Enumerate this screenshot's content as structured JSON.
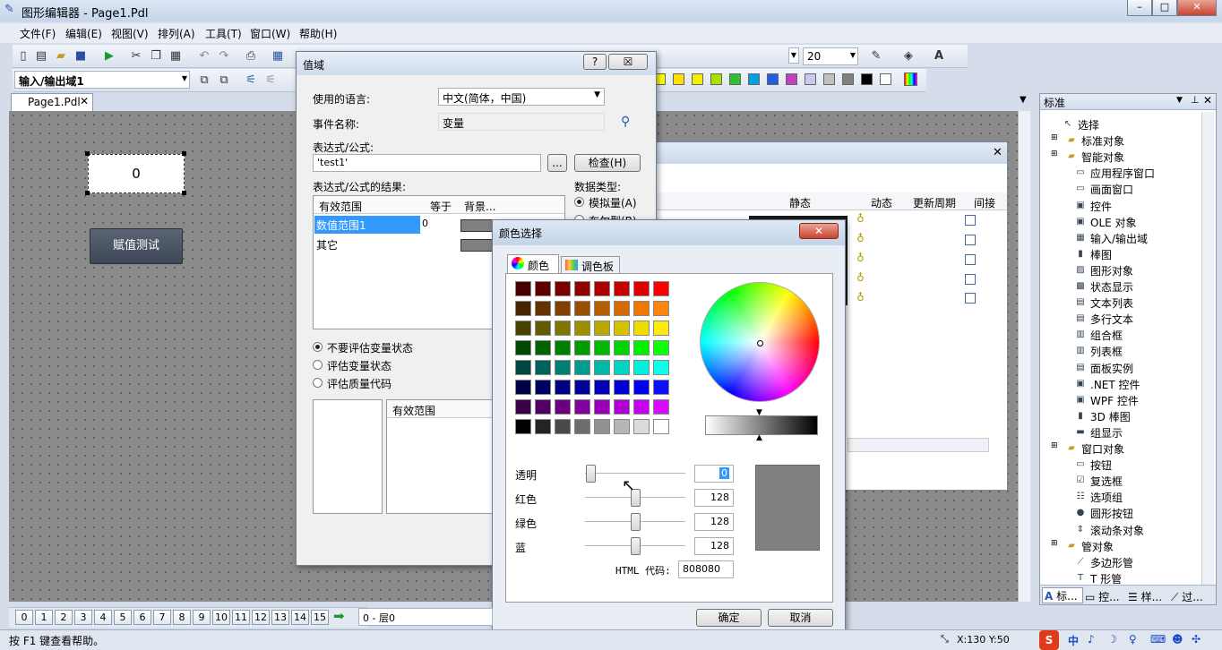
{
  "app": {
    "title": "图形编辑器 - Page1.Pdl"
  },
  "menu": [
    "文件(F)",
    "编辑(E)",
    "视图(V)",
    "排列(A)",
    "工具(T)",
    "窗口(W)",
    "帮助(H)"
  ],
  "toolbar": {
    "field_label": "输入/输出域1",
    "font_size": "20"
  },
  "palette": [
    "#ffff00",
    "#ffe000",
    "#f0f000",
    "#a8e000",
    "#30c030",
    "#00a0e0",
    "#2060e0",
    "#c040c0",
    "#c8c8f0",
    "#c0c0c0",
    "#808080",
    "#000000",
    "#ffffff"
  ],
  "doc_tab": "Page1.Pdl",
  "canvas": {
    "io_value": "0",
    "button_label": "赋值测试"
  },
  "value_dialog": {
    "title": "值域",
    "help_btn": "?",
    "close_btn": "☒",
    "lang_label": "使用的语言:",
    "lang_value": "中文(简体，中国)",
    "event_label": "事件名称:",
    "event_value": "变量",
    "expr_label": "表达式/公式:",
    "expr_value": "'test1'",
    "browse_btn": "...",
    "check_btn": "检查(H)",
    "result_label": "表达式/公式的结果:",
    "cols": [
      "有效范围",
      "等于",
      "背景..."
    ],
    "rows": [
      {
        "name": "数值范围1",
        "eq": "0"
      },
      {
        "name": "其它",
        "eq": ""
      }
    ],
    "dtype_label": "数据类型:",
    "dtype_opts": [
      "模拟量(A)",
      "布尔型(B)"
    ],
    "eval_opts": [
      "不要评估变量状态",
      "评估变量状态",
      "评估质量代码"
    ],
    "bottom_col": "有效范围"
  },
  "back_dialog": {
    "cols": [
      "静态",
      "动态",
      "更新周期",
      "间接"
    ]
  },
  "color_dialog": {
    "title": "颜色选择",
    "tabs": [
      "颜色",
      "调色板"
    ],
    "labels": [
      "透明",
      "红色",
      "绿色",
      "蓝"
    ],
    "values": [
      "0",
      "128",
      "128",
      "128"
    ],
    "html_label": "HTML 代码:",
    "html_value": "808080",
    "ok": "确定",
    "cancel": "取消",
    "preview": "#808080"
  },
  "palette_panel": {
    "title": "标准",
    "items": [
      {
        "t": "选择",
        "lv": 1
      },
      {
        "t": "标准对象",
        "lv": 0
      },
      {
        "t": "智能对象",
        "lv": 0
      },
      {
        "t": "应用程序窗口",
        "lv": 2
      },
      {
        "t": "画面窗口",
        "lv": 2
      },
      {
        "t": "控件",
        "lv": 2
      },
      {
        "t": "OLE 对象",
        "lv": 2
      },
      {
        "t": "输入/输出域",
        "lv": 2
      },
      {
        "t": "棒图",
        "lv": 2
      },
      {
        "t": "图形对象",
        "lv": 2
      },
      {
        "t": "状态显示",
        "lv": 2
      },
      {
        "t": "文本列表",
        "lv": 2
      },
      {
        "t": "多行文本",
        "lv": 2
      },
      {
        "t": "组合框",
        "lv": 2
      },
      {
        "t": "列表框",
        "lv": 2
      },
      {
        "t": "面板实例",
        "lv": 2
      },
      {
        "t": ".NET 控件",
        "lv": 2
      },
      {
        "t": "WPF 控件",
        "lv": 2
      },
      {
        "t": "3D 棒图",
        "lv": 2
      },
      {
        "t": "组显示",
        "lv": 2
      },
      {
        "t": "窗口对象",
        "lv": 0
      },
      {
        "t": "按钮",
        "lv": 2
      },
      {
        "t": "复选框",
        "lv": 2
      },
      {
        "t": "选项组",
        "lv": 2
      },
      {
        "t": "圆形按钮",
        "lv": 2
      },
      {
        "t": "滚动条对象",
        "lv": 2
      },
      {
        "t": "管对象",
        "lv": 0
      },
      {
        "t": "多边形管",
        "lv": 2
      },
      {
        "t": "T 形管",
        "lv": 2
      }
    ],
    "bottom_tabs": [
      "标...",
      "控...",
      "样...",
      "过..."
    ]
  },
  "layers": [
    "0",
    "1",
    "2",
    "3",
    "4",
    "5",
    "6",
    "7",
    "8",
    "9",
    "10",
    "11",
    "12",
    "13",
    "14",
    "15"
  ],
  "layer_field": "0 - 层0",
  "status": {
    "help": "按 F1 键查看帮助。",
    "coords": "X:130 Y:50",
    "tray": "中"
  }
}
